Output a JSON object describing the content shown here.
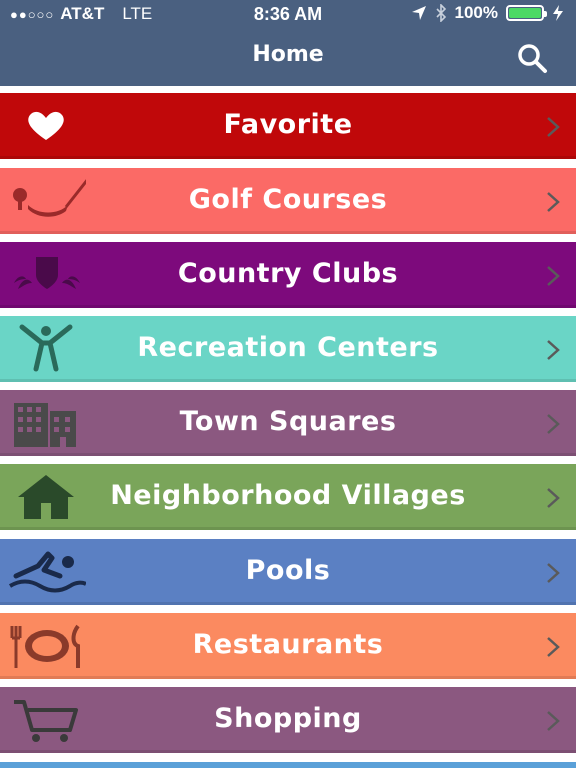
{
  "status": {
    "carrier": "AT&T",
    "network": "LTE",
    "time": "8:36 AM",
    "battery": "100%",
    "battery_level": 1.0
  },
  "nav": {
    "title": "Home",
    "search_icon": "search-icon"
  },
  "colors": {
    "nav_bg": "#4a6080",
    "favorite": "#c0080a",
    "golf": "#fb6a66",
    "country": "#7d0a7c",
    "recreation": "#6ad5c6",
    "town": "#8b5880",
    "neighborhood": "#7aa55a",
    "pools": "#5b80c3",
    "restaurants": "#fb8a60",
    "shopping": "#8b5880"
  },
  "menu": {
    "favorite": {
      "label": "Favorite",
      "icon": "heart-icon"
    },
    "golf": {
      "label": "Golf Courses",
      "icon": "golf-club-icon"
    },
    "country": {
      "label": "Country Clubs",
      "icon": "club-crest-icon"
    },
    "recreation": {
      "label": "Recreation Centers",
      "icon": "person-jumping-icon"
    },
    "town": {
      "label": "Town Squares",
      "icon": "buildings-icon"
    },
    "neighborhood": {
      "label": "Neighborhood Villages",
      "icon": "house-icon"
    },
    "pools": {
      "label": "Pools",
      "icon": "swimmer-icon"
    },
    "restaurants": {
      "label": "Restaurants",
      "icon": "plate-utensils-icon"
    },
    "shopping": {
      "label": "Shopping",
      "icon": "shopping-cart-icon"
    }
  }
}
